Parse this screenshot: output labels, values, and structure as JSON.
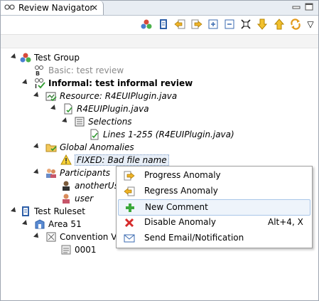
{
  "view": {
    "title": "Review Navigator",
    "close_glyph": "✕",
    "menu_glyph": "▽"
  },
  "toolbar": {
    "buttons": [
      "group-icon",
      "review-icon",
      "previous-icon",
      "next-icon",
      "expand-all-icon",
      "collapse-all-icon",
      "filter-icon",
      "move-down-icon",
      "move-up-icon",
      "refresh-icon"
    ]
  },
  "tree": {
    "group": "Test Group",
    "basic_review": "Basic: test review",
    "informal_review": "Informal: test informal review",
    "resource": "Resource: R4EUIPlugin.java",
    "file": "R4EUIPlugin.java",
    "selections": "Selections",
    "lines": "Lines 1-255 (R4EUIPlugin.java)",
    "global_anomalies": "Global Anomalies",
    "anomaly": "FIXED: Bad file name",
    "participants": "Participants",
    "participant_1": "anotherUse",
    "participant_2": "user",
    "ruleset": "Test Ruleset",
    "area": "Area 51",
    "violation": "Convention Vio",
    "rule": "0001"
  },
  "context_menu": {
    "items": [
      {
        "label": "Progress Anomaly",
        "icon": "progress-icon",
        "accelerator": ""
      },
      {
        "label": "Regress Anomaly",
        "icon": "regress-icon",
        "accelerator": ""
      },
      {
        "label": "New Comment",
        "icon": "add-icon",
        "accelerator": ""
      },
      {
        "label": "Disable Anomaly",
        "icon": "delete-icon",
        "accelerator": "Alt+4, X"
      },
      {
        "label": "Send Email/Notification",
        "icon": "mail-icon",
        "accelerator": ""
      }
    ]
  },
  "colors": {
    "hover_bg": "#eef4fb",
    "hover_border": "#a9c6e8",
    "tab_bar": "#e8edf3"
  }
}
